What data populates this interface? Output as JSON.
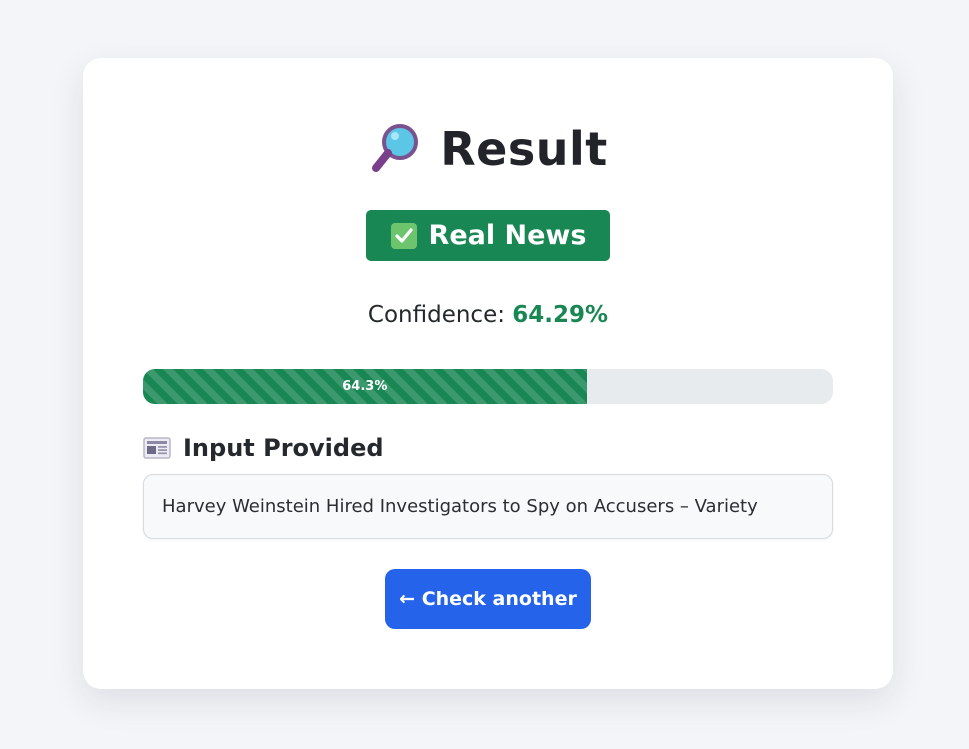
{
  "result": {
    "title": "Result",
    "title_icon": "magnifying-glass-icon",
    "badge": {
      "icon": "check-mark-button-icon",
      "label": "Real News",
      "color": "#198754"
    },
    "confidence": {
      "label": "Confidence:",
      "value": "64.29%"
    },
    "progress": {
      "percent": 64.3,
      "label": "64.3%",
      "color": "#198754"
    },
    "input_section": {
      "icon": "newspaper-icon",
      "heading": "Input Provided",
      "text": "Harvey Weinstein Hired Investigators to Spy on Accusers – Variety"
    },
    "action": {
      "label": "← Check another",
      "color": "#2563eb"
    }
  }
}
